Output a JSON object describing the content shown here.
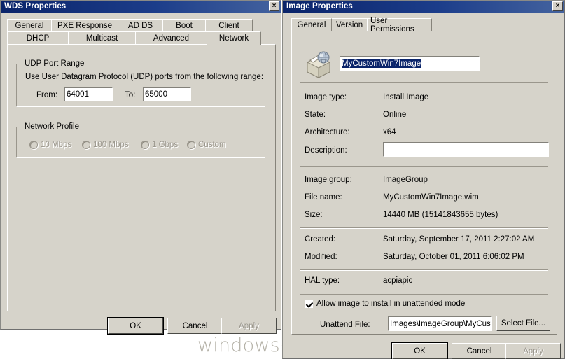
{
  "watermark": {
    "text": "windows-noob.com"
  },
  "wds_dialog": {
    "title": "WDS Properties",
    "close_label": "×",
    "tabs_row1": [
      {
        "label": "General",
        "active": false
      },
      {
        "label": "PXE Response",
        "active": false
      },
      {
        "label": "AD DS",
        "active": false
      },
      {
        "label": "Boot",
        "active": false
      },
      {
        "label": "Client",
        "active": false
      }
    ],
    "tabs_row2": [
      {
        "label": "DHCP",
        "active": false
      },
      {
        "label": "Multicast",
        "active": false
      },
      {
        "label": "Advanced",
        "active": false
      },
      {
        "label": "Network",
        "active": true
      }
    ],
    "udp_group": {
      "legend": "UDP Port Range",
      "description": "Use User Datagram Protocol (UDP) ports from the following range:",
      "from_label": "From:",
      "from_value": "64001",
      "to_label": "To:",
      "to_value": "65000"
    },
    "network_profile_group": {
      "legend": "Network Profile",
      "options": [
        {
          "label": "10 Mbps",
          "selected": false
        },
        {
          "label": "100 Mbps",
          "selected": false
        },
        {
          "label": "1 Gbps",
          "selected": false
        },
        {
          "label": "Custom",
          "selected": false
        }
      ]
    },
    "buttons": {
      "ok": "OK",
      "cancel": "Cancel",
      "apply": "Apply"
    }
  },
  "image_dialog": {
    "title": "Image Properties",
    "close_label": "×",
    "tabs": [
      {
        "label": "General",
        "active": true
      },
      {
        "label": "Version",
        "active": false
      },
      {
        "label": "User Permissions",
        "active": false
      }
    ],
    "icon_name": "install-image-icon",
    "name_field": {
      "value": "MyCustomWin7Image"
    },
    "fields_group1": [
      {
        "label": "Image type:",
        "value": "Install Image"
      },
      {
        "label": "State:",
        "value": "Online"
      },
      {
        "label": "Architecture:",
        "value": "x64"
      }
    ],
    "description": {
      "label": "Description:",
      "value": ""
    },
    "fields_group2": [
      {
        "label": "Image group:",
        "value": "ImageGroup"
      },
      {
        "label": "File name:",
        "value": "MyCustomWin7Image.wim"
      },
      {
        "label": "Size:",
        "value": "14440 MB (15141843655 bytes)"
      }
    ],
    "fields_group3": [
      {
        "label": "Created:",
        "value": "Saturday, September 17, 2011 2:27:02 AM"
      },
      {
        "label": "Modified:",
        "value": "Saturday, October 01, 2011 6:06:02 PM"
      }
    ],
    "fields_group4": [
      {
        "label": "HAL type:",
        "value": "acpiapic"
      }
    ],
    "unattend": {
      "checkbox_label": "Allow image to install in unattended mode",
      "checked": true,
      "file_label": "Unattend File:",
      "file_value": "Images\\ImageGroup\\MyCustor",
      "select_button": "Select File..."
    },
    "buttons": {
      "ok": "OK",
      "cancel": "Cancel",
      "apply": "Apply"
    }
  }
}
